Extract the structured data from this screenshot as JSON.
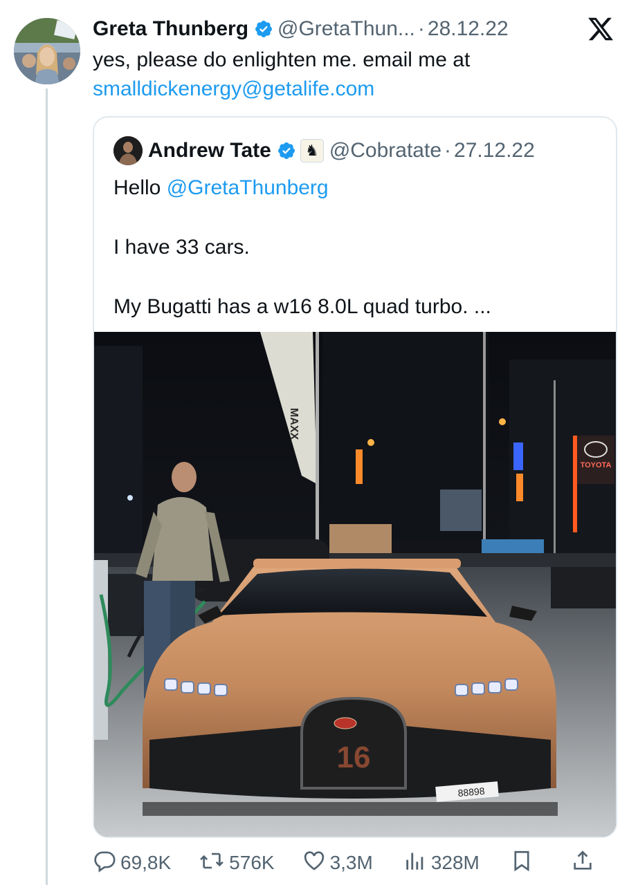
{
  "tweet": {
    "author_name": "Greta Thunberg",
    "handle": "@GretaThun...",
    "separator": "·",
    "date": "28.12.22",
    "text_line1": "yes, please do enlighten me. email me at",
    "email_link": "smalldickenergy@getalife.com"
  },
  "quoted": {
    "author_name": "Andrew Tate",
    "handle": "@Cobratate",
    "separator": "·",
    "date": "27.12.22",
    "greeting": "Hello ",
    "mention": "@GretaThunberg",
    "line2": "I have 33 cars.",
    "line3": "My Bugatti has a w16 8.0L quad turbo. ...",
    "photo_sign_banner": "MAXX",
    "photo_sign_toyota": "TOYOTA",
    "photo_car_number": "16",
    "photo_plate": "88898"
  },
  "actions": {
    "replies": "69,8K",
    "retweets": "576K",
    "likes": "3,3M",
    "views": "328M"
  },
  "colors": {
    "link": "#1d9bf0",
    "verified": "#1d9bf0",
    "muted": "#536471",
    "car": "#c98f62"
  },
  "icons": [
    "verified-badge-icon",
    "x-logo-icon",
    "knight-icon",
    "reply-icon",
    "retweet-icon",
    "like-icon",
    "views-icon",
    "bookmark-icon",
    "share-icon"
  ]
}
